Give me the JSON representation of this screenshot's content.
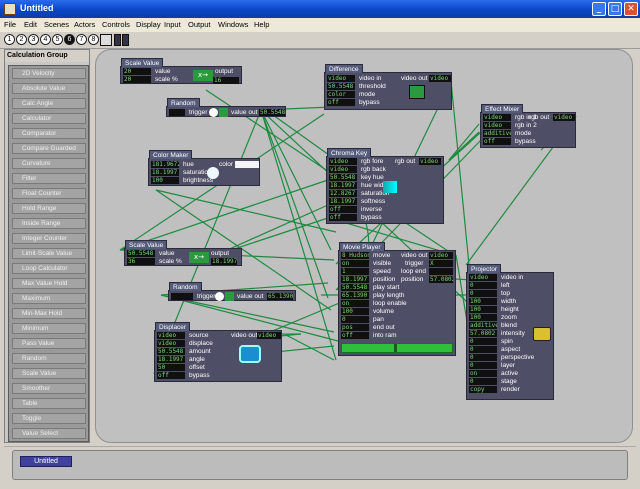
{
  "window": {
    "title": "Untitled",
    "controls": [
      "_",
      "□",
      "✕"
    ]
  },
  "menu": [
    "File",
    "Edit",
    "Scenes",
    "Actors",
    "Controls",
    "Display",
    "Input",
    "Output",
    "Windows",
    "Help"
  ],
  "scene_buttons": [
    "1",
    "2",
    "3",
    "4",
    "5",
    "6",
    "7",
    "8"
  ],
  "active_scene": "6",
  "library": {
    "header": "Calculation Group",
    "items": [
      "2D Velocity",
      "Absolute Value",
      "Calc Angle",
      "Calculator",
      "Comparator",
      "Compare Guarded",
      "Curvature",
      "Filter",
      "Float Counter",
      "Hold Range",
      "Inside Range",
      "Integer Counter",
      "Limit-Scale Value",
      "Loop Calculator",
      "Max Value Hold",
      "Maximum",
      "Min-Max Hold",
      "Minimum",
      "Pass Value",
      "Random",
      "Scale Value",
      "Smoother",
      "Table",
      "Toggle",
      "Value Select"
    ]
  },
  "actors": {
    "scale1": {
      "title": "Scale Value",
      "inputs": [
        {
          "v": "20",
          "l": "value"
        },
        {
          "v": "20",
          "l": "scale %"
        }
      ],
      "out_label": "output",
      "out_value": "16"
    },
    "random1": {
      "title": "Random",
      "in_label": "trigger",
      "out_label": "value out",
      "out_value": "50.5548"
    },
    "difference": {
      "title": "Difference",
      "inputs": [
        {
          "v": "video",
          "l": "video in"
        },
        {
          "v": "50.5548",
          "l": "threshold"
        },
        {
          "v": "color",
          "l": "mode"
        },
        {
          "v": "off",
          "l": "bypass"
        }
      ],
      "out_label": "video out",
      "out_value": "video"
    },
    "colormaker": {
      "title": "Color Maker",
      "inputs": [
        {
          "v": "181.9672",
          "l": "hue"
        },
        {
          "v": "18.1997",
          "l": "saturation"
        },
        {
          "v": "100",
          "l": "brightness"
        }
      ],
      "out_label": "color"
    },
    "chromakey": {
      "title": "Chroma Key",
      "inputs": [
        {
          "v": "video",
          "l": "rgb fore"
        },
        {
          "v": "video",
          "l": "rgb back"
        },
        {
          "v": "50.5548",
          "l": "key hue"
        },
        {
          "v": "18.1997",
          "l": "hue width"
        },
        {
          "v": "12.8267",
          "l": "saturation"
        },
        {
          "v": "18.1997",
          "l": "softness"
        },
        {
          "v": "off",
          "l": "inverse"
        },
        {
          "v": "off",
          "l": "bypass"
        }
      ],
      "out_label": "rgb out",
      "out_value": "video"
    },
    "effectmixer": {
      "title": "Effect Mixer",
      "inputs": [
        {
          "v": "video",
          "l": "rgb in 1"
        },
        {
          "v": "video",
          "l": "rgb in 2"
        },
        {
          "v": "additive",
          "l": "mode"
        },
        {
          "v": "off",
          "l": "bypass"
        }
      ],
      "out_label": "rgb out",
      "out_value": "video"
    },
    "scale2": {
      "title": "Scale Value",
      "inputs": [
        {
          "v": "50.5548",
          "l": "value"
        },
        {
          "v": "36",
          "l": "scale %"
        }
      ],
      "out_label": "output",
      "out_value": "18.1997"
    },
    "movieplayer": {
      "title": "Movie Player",
      "inputs": [
        {
          "v": "8 Hudson",
          "l": "movie"
        },
        {
          "v": "on",
          "l": "visible"
        },
        {
          "v": "1",
          "l": "speed"
        },
        {
          "v": "18.1997",
          "l": "position"
        },
        {
          "v": "50.5548",
          "l": "play start"
        },
        {
          "v": "65.1390",
          "l": "play length"
        },
        {
          "v": "on",
          "l": "loop enable"
        },
        {
          "v": "100",
          "l": "volume"
        },
        {
          "v": "0",
          "l": "pan"
        },
        {
          "v": "pos",
          "l": "end out"
        },
        {
          "v": "off",
          "l": "into ram"
        }
      ],
      "outputs": [
        {
          "l": "video out",
          "v": "video"
        },
        {
          "l": "trigger",
          "v": "X"
        },
        {
          "l": "loop end",
          "v": ""
        },
        {
          "l": "position",
          "v": "57.0802"
        }
      ]
    },
    "random2": {
      "title": "Random",
      "in_label": "trigger",
      "out_label": "value out",
      "out_value": "65.1390"
    },
    "displacer": {
      "title": "Displacer",
      "inputs": [
        {
          "v": "video",
          "l": "source"
        },
        {
          "v": "video",
          "l": "displace"
        },
        {
          "v": "50.5548",
          "l": "amount"
        },
        {
          "v": "18.1997",
          "l": "angle"
        },
        {
          "v": "50",
          "l": "offset"
        },
        {
          "v": "off",
          "l": "bypass"
        }
      ],
      "out_label": "video out",
      "out_value": "video"
    },
    "projector": {
      "title": "Projector",
      "inputs": [
        {
          "v": "video",
          "l": "video in"
        },
        {
          "v": "0",
          "l": "left"
        },
        {
          "v": "0",
          "l": "top"
        },
        {
          "v": "100",
          "l": "width"
        },
        {
          "v": "100",
          "l": "height"
        },
        {
          "v": "100",
          "l": "zoom"
        },
        {
          "v": "additive",
          "l": "blend"
        },
        {
          "v": "57.0802",
          "l": "intensity"
        },
        {
          "v": "0",
          "l": "spin"
        },
        {
          "v": "0",
          "l": "aspect"
        },
        {
          "v": "0",
          "l": "perspective"
        },
        {
          "v": "0",
          "l": "layer"
        },
        {
          "v": "on",
          "l": "active"
        },
        {
          "v": "0",
          "l": "stage"
        },
        {
          "v": "copy",
          "l": "render"
        }
      ]
    }
  },
  "bottom_tab": "Untitled",
  "colors": {
    "canvas": "#c0c0c0",
    "actor": "#4e4e66",
    "wire": "#1f8a3f",
    "title": "#0a46c8"
  }
}
